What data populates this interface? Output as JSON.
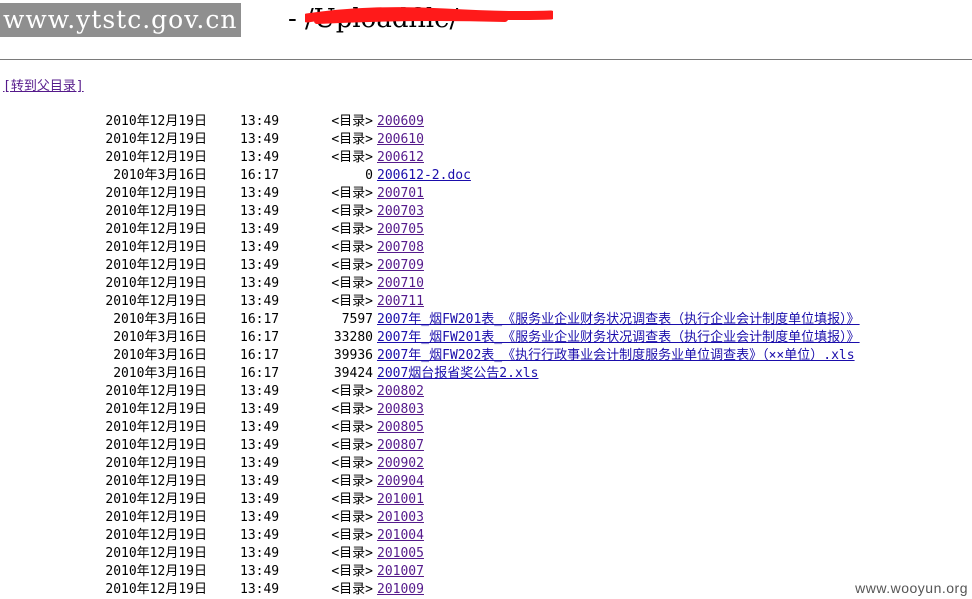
{
  "header": {
    "site": "www.ytstc.gov.cn",
    "title": "- /Uploadfile/"
  },
  "parent_link": "[转到父目录]",
  "entries": [
    {
      "date": "2010年12月19日",
      "time": "13:49",
      "size": "<目录>",
      "name": "200609",
      "is_dir": true
    },
    {
      "date": "2010年12月19日",
      "time": "13:49",
      "size": "<目录>",
      "name": "200610",
      "is_dir": true
    },
    {
      "date": "2010年12月19日",
      "time": "13:49",
      "size": "<目录>",
      "name": "200612",
      "is_dir": true
    },
    {
      "date": "2010年3月16日",
      "time": "16:17",
      "size": "0",
      "name": "200612-2.doc",
      "is_dir": false
    },
    {
      "date": "2010年12月19日",
      "time": "13:49",
      "size": "<目录>",
      "name": "200701",
      "is_dir": true
    },
    {
      "date": "2010年12月19日",
      "time": "13:49",
      "size": "<目录>",
      "name": "200703",
      "is_dir": true
    },
    {
      "date": "2010年12月19日",
      "time": "13:49",
      "size": "<目录>",
      "name": "200705",
      "is_dir": true
    },
    {
      "date": "2010年12月19日",
      "time": "13:49",
      "size": "<目录>",
      "name": "200708",
      "is_dir": true
    },
    {
      "date": "2010年12月19日",
      "time": "13:49",
      "size": "<目录>",
      "name": "200709",
      "is_dir": true
    },
    {
      "date": "2010年12月19日",
      "time": "13:49",
      "size": "<目录>",
      "name": "200710",
      "is_dir": true
    },
    {
      "date": "2010年12月19日",
      "time": "13:49",
      "size": "<目录>",
      "name": "200711",
      "is_dir": true
    },
    {
      "date": "2010年3月16日",
      "time": "16:17",
      "size": "7597",
      "name": "2007年_烟FW201表_《服务业企业财务状况调查表（执行企业会计制度单位填报）》",
      "is_dir": false
    },
    {
      "date": "2010年3月16日",
      "time": "16:17",
      "size": "33280",
      "name": "2007年_烟FW201表_《服务业企业财务状况调查表（执行企业会计制度单位填报）》",
      "is_dir": false
    },
    {
      "date": "2010年3月16日",
      "time": "16:17",
      "size": "39936",
      "name": "2007年_烟FW202表_《执行行政事业会计制度服务业单位调查表》（××单位）.xls",
      "is_dir": false
    },
    {
      "date": "2010年3月16日",
      "time": "16:17",
      "size": "39424",
      "name": "2007烟台报省奖公告2.xls",
      "is_dir": false
    },
    {
      "date": "2010年12月19日",
      "time": "13:49",
      "size": "<目录>",
      "name": "200802",
      "is_dir": true
    },
    {
      "date": "2010年12月19日",
      "time": "13:49",
      "size": "<目录>",
      "name": "200803",
      "is_dir": true
    },
    {
      "date": "2010年12月19日",
      "time": "13:49",
      "size": "<目录>",
      "name": "200805",
      "is_dir": true
    },
    {
      "date": "2010年12月19日",
      "time": "13:49",
      "size": "<目录>",
      "name": "200807",
      "is_dir": true
    },
    {
      "date": "2010年12月19日",
      "time": "13:49",
      "size": "<目录>",
      "name": "200902",
      "is_dir": true
    },
    {
      "date": "2010年12月19日",
      "time": "13:49",
      "size": "<目录>",
      "name": "200904",
      "is_dir": true
    },
    {
      "date": "2010年12月19日",
      "time": "13:49",
      "size": "<目录>",
      "name": "201001",
      "is_dir": true
    },
    {
      "date": "2010年12月19日",
      "time": "13:49",
      "size": "<目录>",
      "name": "201003",
      "is_dir": true
    },
    {
      "date": "2010年12月19日",
      "time": "13:49",
      "size": "<目录>",
      "name": "201004",
      "is_dir": true
    },
    {
      "date": "2010年12月19日",
      "time": "13:49",
      "size": "<目录>",
      "name": "201005",
      "is_dir": true
    },
    {
      "date": "2010年12月19日",
      "time": "13:49",
      "size": "<目录>",
      "name": "201007",
      "is_dir": true
    },
    {
      "date": "2010年12月19日",
      "time": "13:49",
      "size": "<目录>",
      "name": "201009",
      "is_dir": true
    }
  ],
  "watermark": "www.wooyun.org",
  "colors": {
    "link": "#1a0dab",
    "visited_link": "#551a8b",
    "redaction": "#ff1a1a",
    "site_mark_bg": "#8f8f8f"
  }
}
